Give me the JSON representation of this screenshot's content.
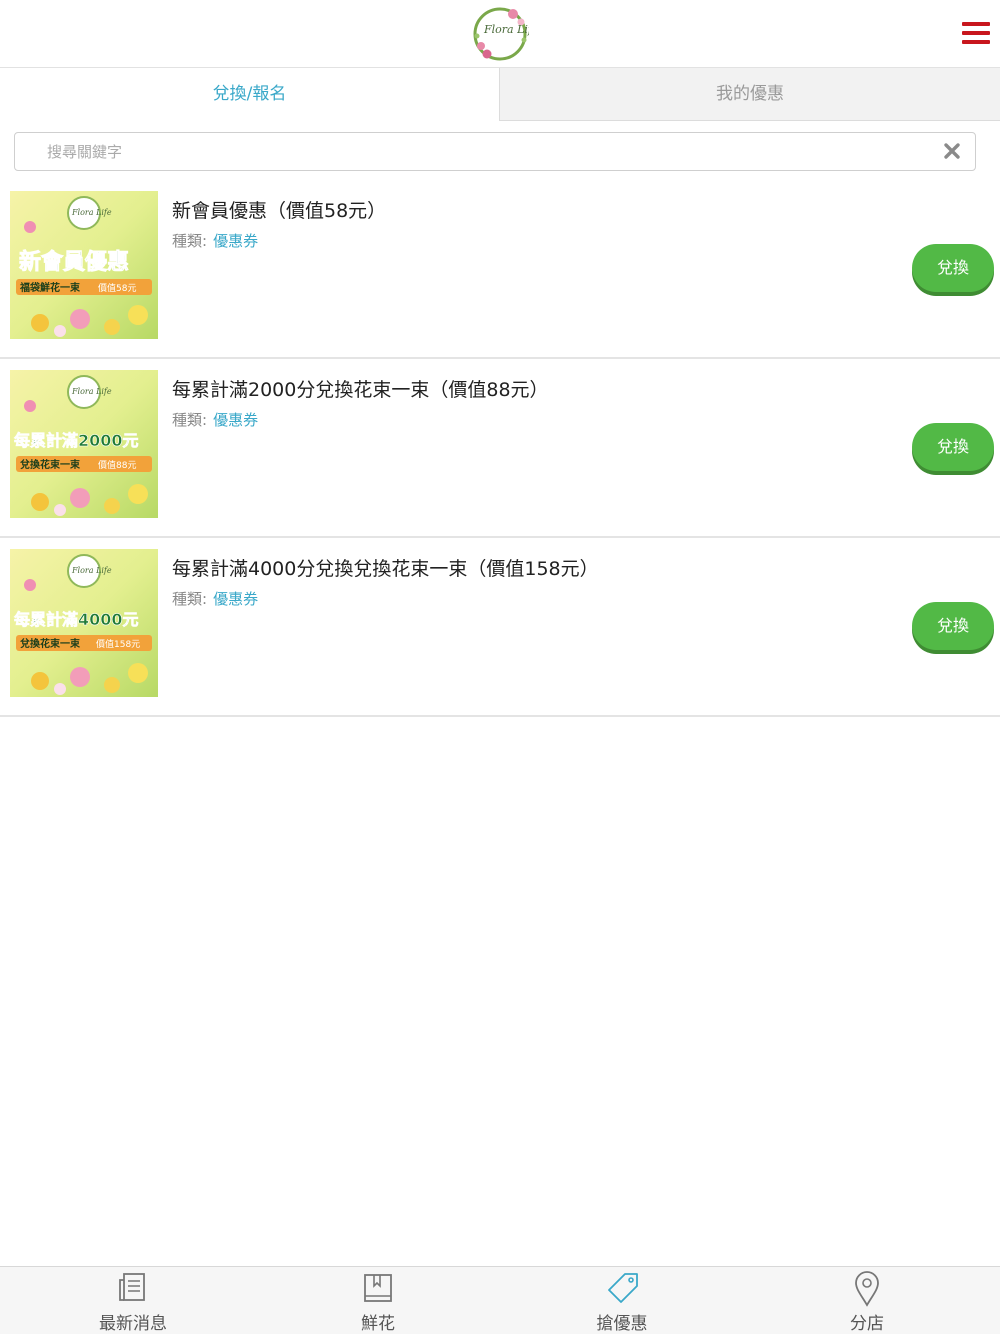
{
  "header": {
    "logo_text": "Flora Life",
    "menu_icon": "hamburger-menu-icon",
    "menu_color": "#c8161d"
  },
  "tabs": [
    {
      "label": "兌換/報名",
      "active": true
    },
    {
      "label": "我的優惠",
      "active": false
    }
  ],
  "search": {
    "placeholder": "搜尋關鍵字",
    "value": "",
    "clear_icon": "close-x-icon"
  },
  "coupons": [
    {
      "title": "新會員優惠（價值58元）",
      "type_label": "種類:",
      "type_value": "優惠券",
      "button": "兌換",
      "thumb": {
        "logo": "Flora Life",
        "headline": "新會員優惠",
        "sub": "福袋鮮花一束",
        "tag": "價值58元"
      }
    },
    {
      "title": "每累計滿2000分兌換花束一束（價值88元）",
      "type_label": "種類:",
      "type_value": "優惠券",
      "button": "兌換",
      "thumb": {
        "logo": "Flora Life",
        "headline": "每累計滿2000元",
        "sub": "兌換花束一束",
        "tag": "價值88元"
      }
    },
    {
      "title": "每累計滿4000分兌換兌換花束一束（價值158元）",
      "type_label": "種類:",
      "type_value": "優惠券",
      "button": "兌換",
      "thumb": {
        "logo": "Flora Life",
        "headline": "每累計滿4000元",
        "sub": "兌換花束一束",
        "tag": "價值158元"
      }
    }
  ],
  "tabbar": [
    {
      "label": "最新消息",
      "icon": "news-icon",
      "active": false
    },
    {
      "label": "鮮花",
      "icon": "book-icon",
      "active": false
    },
    {
      "label": "搶優惠",
      "icon": "price-tag-icon",
      "active": true
    },
    {
      "label": "分店",
      "icon": "location-pin-icon",
      "active": false
    }
  ],
  "colors": {
    "accent": "#3aa8c9",
    "button_green": "#52b946",
    "menu_red": "#c8161d"
  }
}
